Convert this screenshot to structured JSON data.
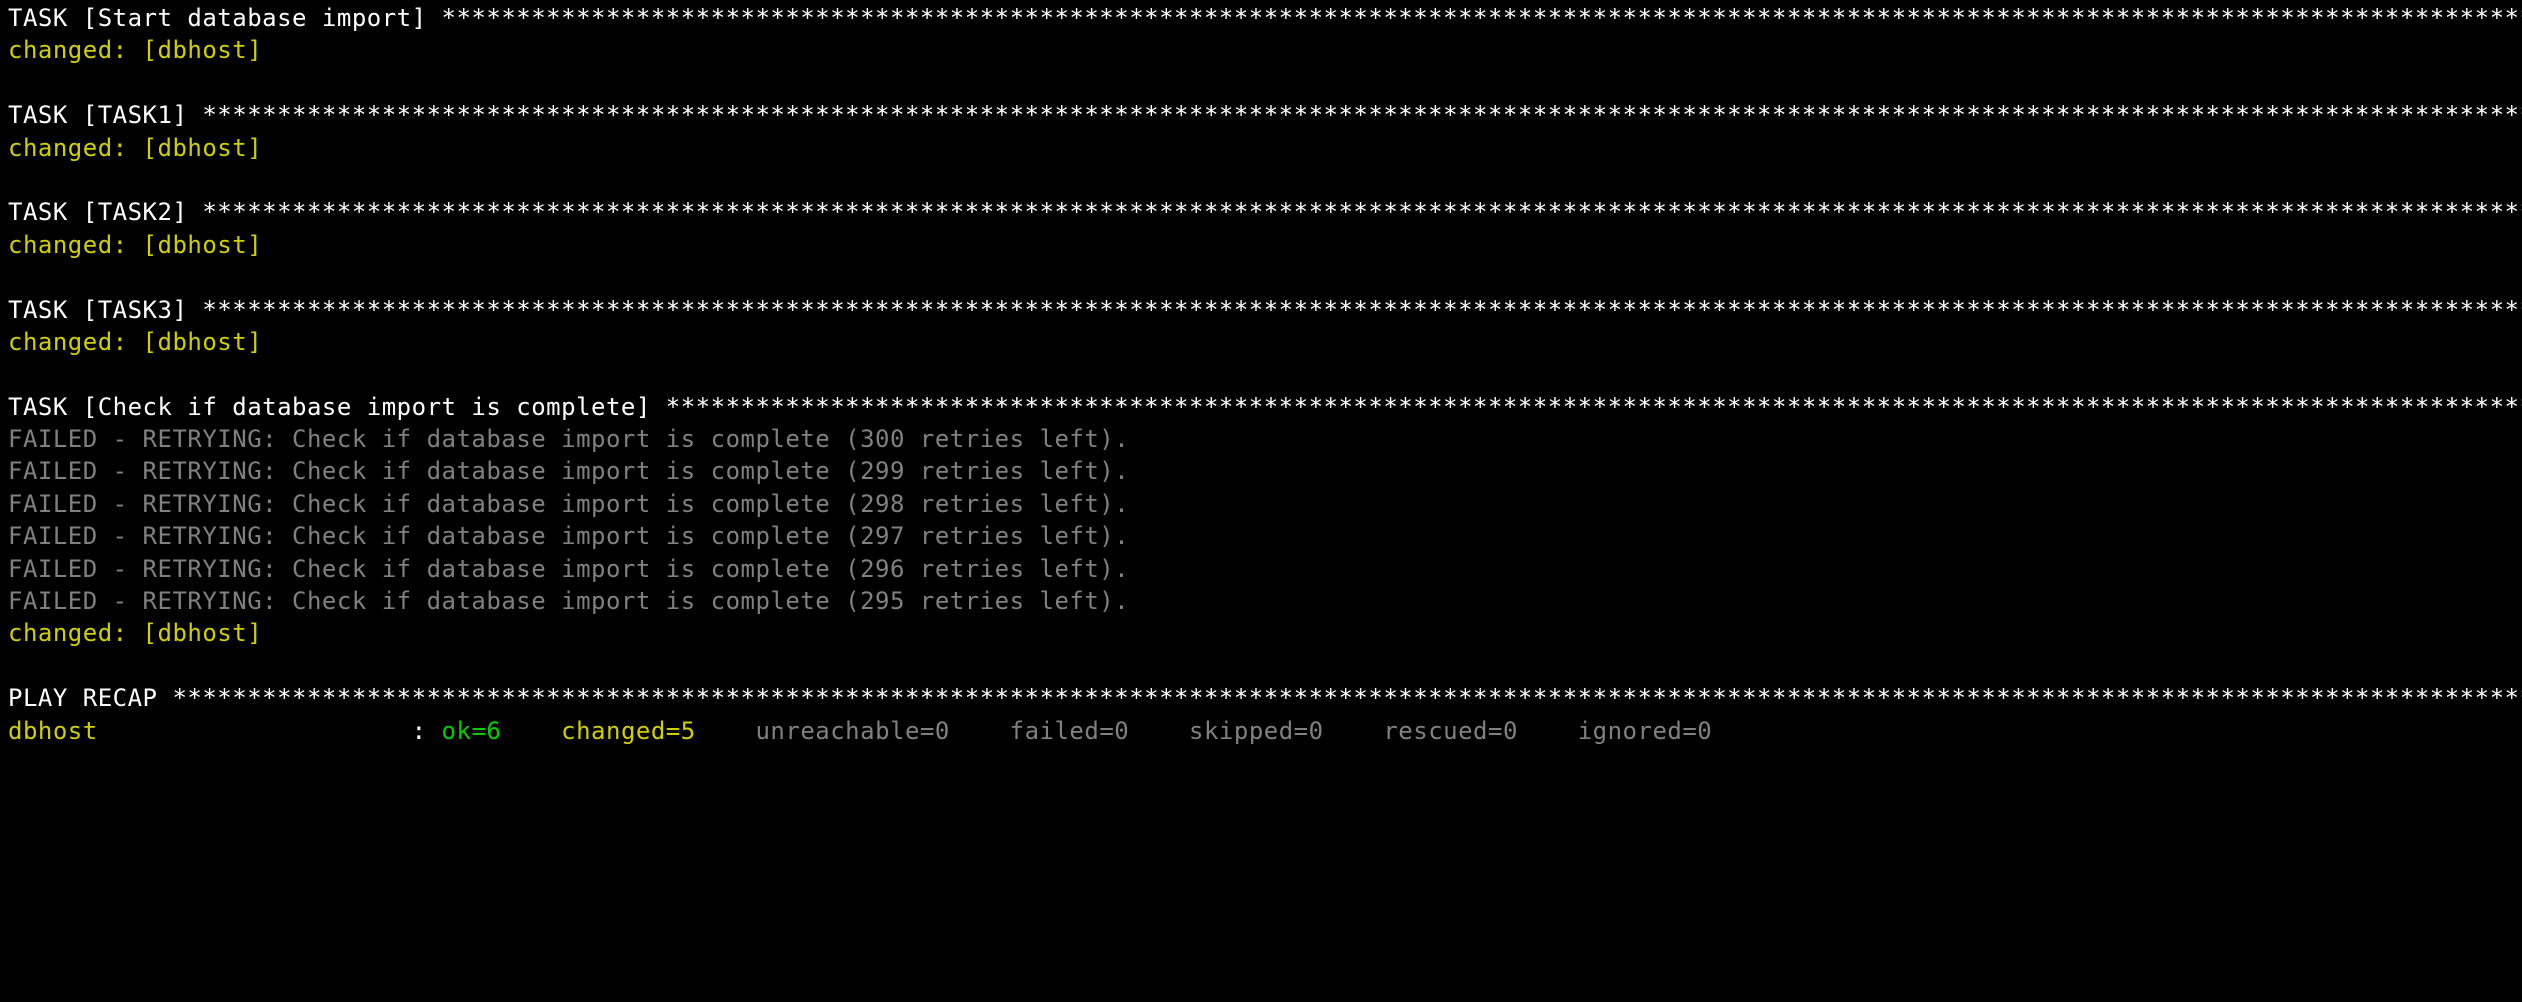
{
  "line_width": 179,
  "tasks": [
    {
      "name": "Start database import",
      "result": "changed: [dbhost]"
    },
    {
      "name": "TASK1",
      "result": "changed: [dbhost]"
    },
    {
      "name": "TASK2",
      "result": "changed: [dbhost]"
    },
    {
      "name": "TASK3",
      "result": "changed: [dbhost]"
    }
  ],
  "check_task": {
    "name": "Check if database import is complete",
    "retries": [
      "FAILED - RETRYING: Check if database import is complete (300 retries left).",
      "FAILED - RETRYING: Check if database import is complete (299 retries left).",
      "FAILED - RETRYING: Check if database import is complete (298 retries left).",
      "FAILED - RETRYING: Check if database import is complete (297 retries left).",
      "FAILED - RETRYING: Check if database import is complete (296 retries left).",
      "FAILED - RETRYING: Check if database import is complete (295 retries left)."
    ],
    "result": "changed: [dbhost]"
  },
  "recap": {
    "title": "PLAY RECAP",
    "host": "dbhost",
    "host_col_width": 27,
    "ok": "ok=6",
    "changed": "changed=5",
    "unreachable": "unreachable=0",
    "failed": "failed=0",
    "skipped": "skipped=0",
    "rescued": "rescued=0",
    "ignored": "ignored=0"
  }
}
